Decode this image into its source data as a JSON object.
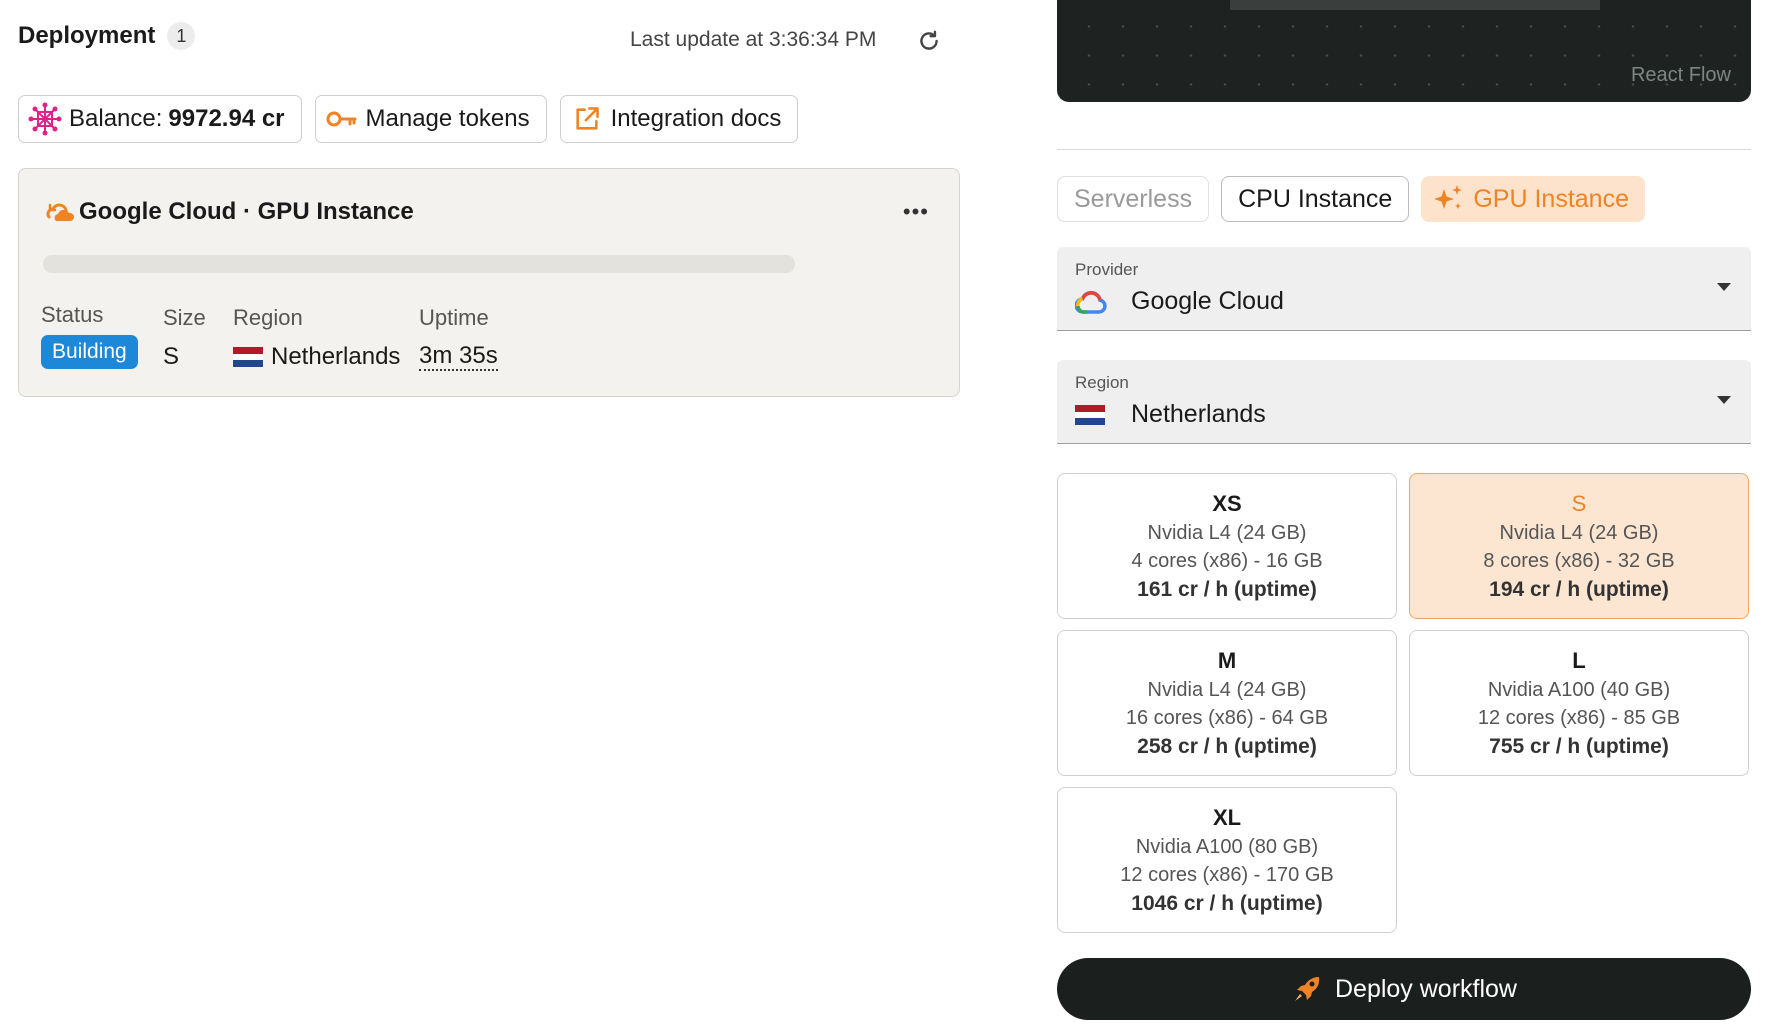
{
  "deployment": {
    "title": "Deployment",
    "count": "1",
    "last_update": "Last update at 3:36:34 PM"
  },
  "chips": {
    "balance_label": "Balance:",
    "balance_value": "9972.94 cr",
    "manage_tokens": "Manage tokens",
    "integration_docs": "Integration docs"
  },
  "instance_card": {
    "title": "Google Cloud · GPU Instance",
    "menu": "•••",
    "progress": 0,
    "status_label": "Status",
    "status_value": "Building",
    "size_label": "Size",
    "size_value": "S",
    "region_label": "Region",
    "region_value": "Netherlands",
    "uptime_label": "Uptime",
    "uptime_value": "3m 35s"
  },
  "canvas": {
    "watermark": "React Flow"
  },
  "modes": {
    "serverless": "Serverless",
    "cpu": "CPU Instance",
    "gpu": "GPU Instance"
  },
  "provider": {
    "label": "Provider",
    "value": "Google Cloud"
  },
  "region": {
    "label": "Region",
    "value": "Netherlands"
  },
  "sizes": [
    {
      "size": "XS",
      "gpu": "Nvidia L4 (24 GB)",
      "cpu": "4 cores (x86) - 16 GB",
      "price": "161 cr / h (uptime)"
    },
    {
      "size": "S",
      "gpu": "Nvidia L4 (24 GB)",
      "cpu": "8 cores (x86) - 32 GB",
      "price": "194 cr / h (uptime)"
    },
    {
      "size": "M",
      "gpu": "Nvidia L4 (24 GB)",
      "cpu": "16 cores (x86) - 64 GB",
      "price": "258 cr / h (uptime)"
    },
    {
      "size": "L",
      "gpu": "Nvidia A100 (40 GB)",
      "cpu": "12 cores (x86) - 85 GB",
      "price": "755 cr / h (uptime)"
    },
    {
      "size": "XL",
      "gpu": "Nvidia A100 (80 GB)",
      "cpu": "12 cores (x86) - 170 GB",
      "price": "1046 cr / h (uptime)"
    }
  ],
  "deploy_button": "Deploy workflow",
  "colors": {
    "accent": "#f08324",
    "accent_bg": "#fde3cc",
    "status_building": "#1e88d8",
    "dark_bg": "#1b1f1e",
    "balance_icon": "#e0218a"
  },
  "icons": {
    "balance": "sparkle-node-icon",
    "tokens": "key-icon",
    "docs": "external-link-icon",
    "refresh": "refresh-icon",
    "card_title": "cloud-sync-icon",
    "gpu_mode": "sparkles-icon",
    "provider": "google-cloud-icon",
    "region": "netherlands-flag-icon",
    "deploy": "rocket-icon"
  }
}
